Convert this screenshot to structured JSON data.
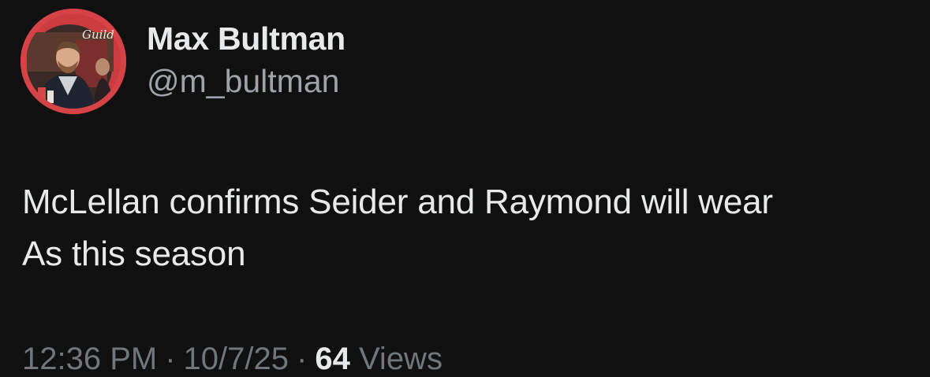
{
  "author": {
    "display_name": "Max Bultman",
    "handle": "@m_bultman",
    "avatar_badge_text": "Guild"
  },
  "tweet": {
    "text_line_1": "McLellan confirms Seider and Raymond will wear",
    "text_line_2": "As this season"
  },
  "meta": {
    "time": "12:36 PM",
    "separator": "·",
    "date": "10/7/25",
    "views_count": "64",
    "views_label": "Views"
  },
  "colors": {
    "background": "#101010",
    "primary_text": "#e7e9ea",
    "secondary_text": "#71767b",
    "avatar_ring": "#c9393b"
  }
}
